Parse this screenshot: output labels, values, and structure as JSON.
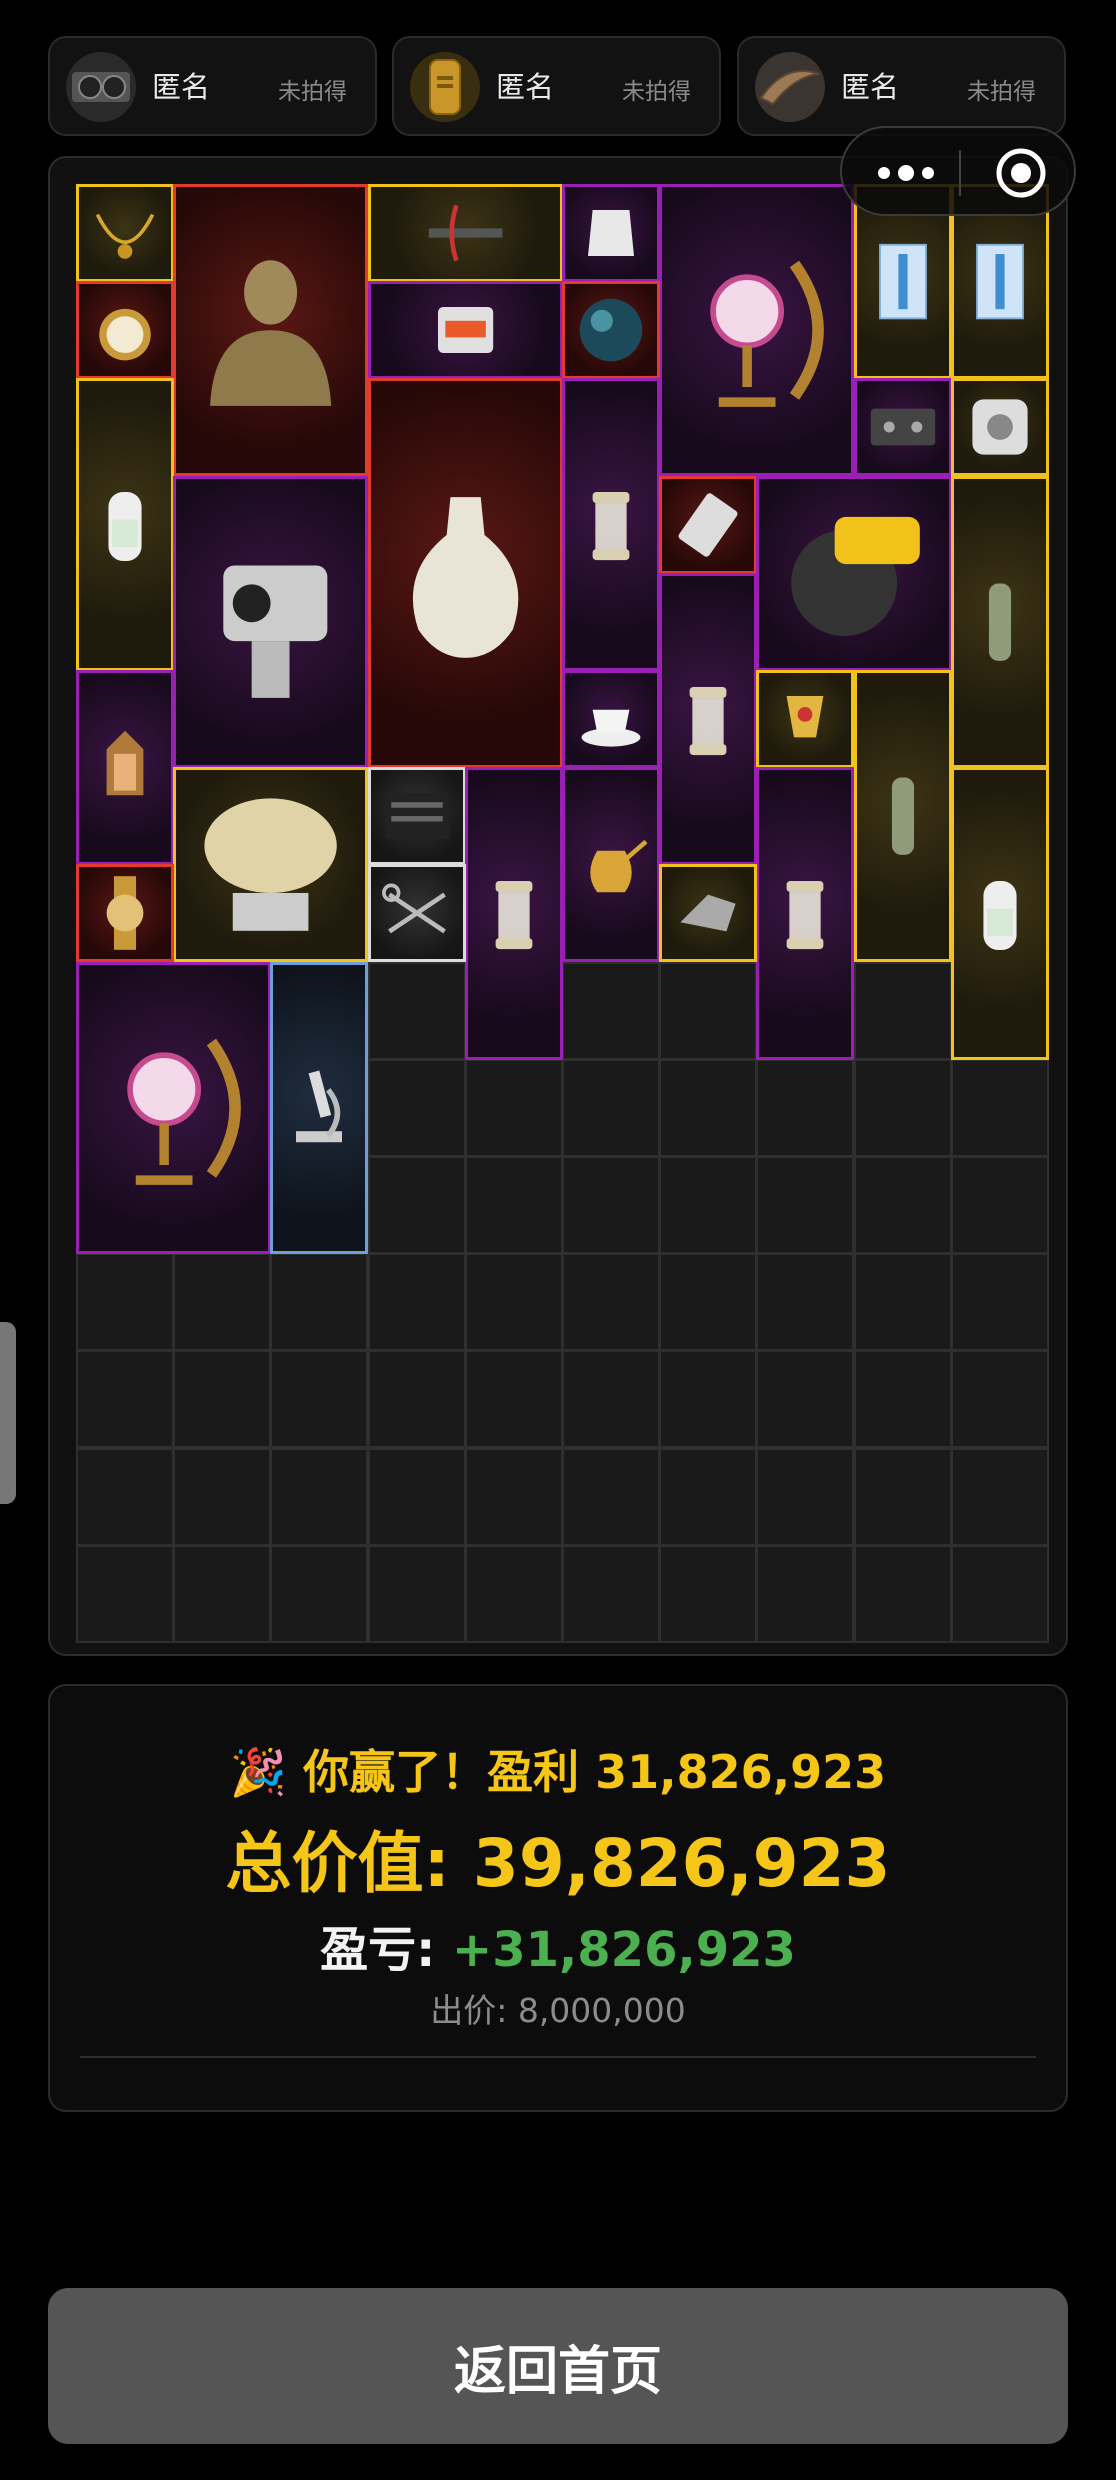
{
  "players": [
    {
      "name": "匿名",
      "status": "未拍得",
      "avatar_icon": "graphics-card-icon"
    },
    {
      "name": "匿名",
      "status": "未拍得",
      "avatar_icon": "dog-tag-icon"
    },
    {
      "name": "匿名",
      "status": "未拍得",
      "avatar_icon": "horn-icon"
    }
  ],
  "capsule": {
    "more_icon": "more-dots-icon",
    "close_icon": "target-circle-icon"
  },
  "inventory": {
    "columns": 10,
    "rows": 15,
    "colors": {
      "gold": "#f2c21a",
      "purple": "#9a1fb5",
      "red": "#e23a2e",
      "blue": "#6d9fdb",
      "white": "#dcdcdc",
      "empty": "#1a1a1a"
    },
    "items": [
      {
        "name": "gold-necklace",
        "quality": "gold"
      },
      {
        "name": "bronze-bust",
        "quality": "red"
      },
      {
        "name": "crossbow",
        "quality": "gold"
      },
      {
        "name": "body-armor-plate",
        "quality": "purple"
      },
      {
        "name": "mosaic-moon-lamp",
        "quality": "purple"
      },
      {
        "name": "blue-syringe-pack",
        "quality": "gold"
      },
      {
        "name": "blue-syringe-pack",
        "quality": "gold"
      },
      {
        "name": "pocket-watch",
        "quality": "red"
      },
      {
        "name": "edc-card-pack",
        "quality": "purple"
      },
      {
        "name": "dark-orb",
        "quality": "red"
      },
      {
        "name": "oxygen-tank",
        "quality": "gold"
      },
      {
        "name": "white-porcelain-vase",
        "quality": "red"
      },
      {
        "name": "camping-lantern",
        "quality": "purple"
      },
      {
        "name": "cassette-tape",
        "quality": "purple"
      },
      {
        "name": "portal-cube",
        "quality": "gold"
      },
      {
        "name": "thermal-camera",
        "quality": "purple"
      },
      {
        "name": "usb-drive",
        "quality": "red"
      },
      {
        "name": "circular-saw",
        "quality": "purple"
      },
      {
        "name": "drawing-tube",
        "quality": "gold"
      },
      {
        "name": "camping-lantern",
        "quality": "purple"
      },
      {
        "name": "ornate-lantern",
        "quality": "purple"
      },
      {
        "name": "teacup",
        "quality": "purple"
      },
      {
        "name": "golden-cup",
        "quality": "gold"
      },
      {
        "name": "drawing-tube",
        "quality": "gold"
      },
      {
        "name": "radar-dish",
        "quality": "gold"
      },
      {
        "name": "screwdriver-kit",
        "quality": "white"
      },
      {
        "name": "camping-lantern",
        "quality": "purple"
      },
      {
        "name": "golden-teapot",
        "quality": "purple"
      },
      {
        "name": "camping-lantern",
        "quality": "purple"
      },
      {
        "name": "oxygen-tank",
        "quality": "gold"
      },
      {
        "name": "gold-watch",
        "quality": "red"
      },
      {
        "name": "scissors",
        "quality": "white"
      },
      {
        "name": "car-part",
        "quality": "gold"
      },
      {
        "name": "mosaic-moon-lamp",
        "quality": "purple"
      },
      {
        "name": "microscope",
        "quality": "blue"
      }
    ]
  },
  "result": {
    "emoji": "🎉",
    "win_text": "你赢了！盈利 31,826,923",
    "total_label": "总价值: ",
    "total_value": "39,826,923",
    "pnl_label": "盈亏: ",
    "pnl_value": "+31,826,923",
    "bid_text": "出价: 8,000,000",
    "positive_color": "#4caf50",
    "accent_color": "#f5c518"
  },
  "home_button_label": "返回首页"
}
